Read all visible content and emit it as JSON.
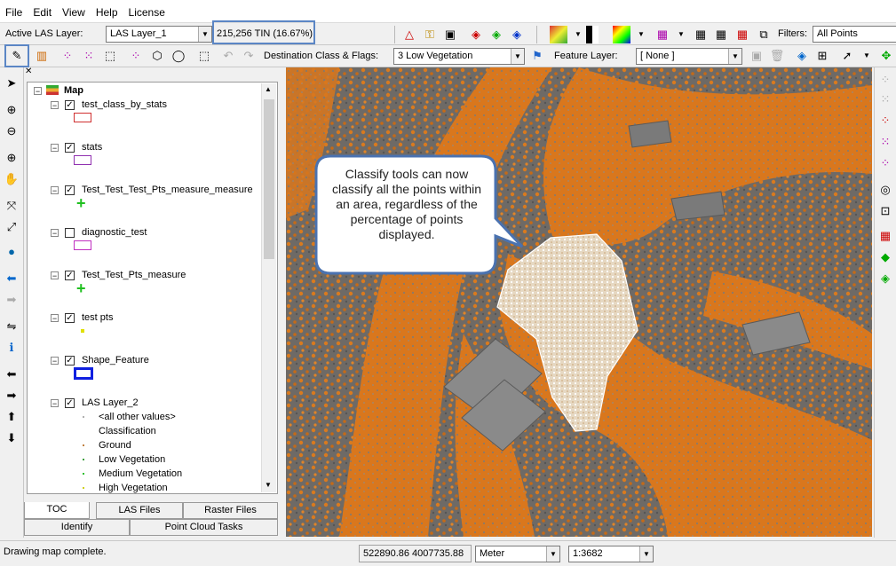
{
  "menu": [
    "File",
    "Edit",
    "View",
    "Help",
    "License"
  ],
  "toolbar1": {
    "active_layer_label": "Active LAS Layer:",
    "active_layer_value": "LAS Layer_1",
    "point_info": "215,256 TIN (16.67%)",
    "filters_label": "Filters:",
    "filters_value": "All Points"
  },
  "toolbar2": {
    "dest_label": "Destination Class & Flags:",
    "dest_value": "3   Low Vegetation",
    "feature_label": "Feature Layer:",
    "feature_value": "[ None ]"
  },
  "toc": {
    "root": "Map",
    "layers": [
      {
        "name": "test_class_by_stats",
        "checked": true,
        "symbol": "rect",
        "color": "#d03030"
      },
      {
        "name": "stats",
        "checked": true,
        "symbol": "rect",
        "color": "#9030b0"
      },
      {
        "name": "Test_Test_Test_Pts_measure_measure",
        "checked": true,
        "symbol": "cross",
        "color": "#20c020"
      },
      {
        "name": "diagnostic_test",
        "checked": false,
        "symbol": "rect",
        "color": "#c030c0"
      },
      {
        "name": "Test_Test_Pts_measure",
        "checked": true,
        "symbol": "cross",
        "color": "#20c020"
      },
      {
        "name": "test pts",
        "checked": true,
        "symbol": "dot",
        "color": "#e0e000"
      },
      {
        "name": "Shape_Feature",
        "checked": true,
        "symbol": "bluebox",
        "color": "#1020e0"
      },
      {
        "name": "LAS Layer_2",
        "checked": true,
        "symbol": "none",
        "color": ""
      }
    ],
    "las_values": [
      {
        "name": "<all other values>",
        "color": "#b0b0b0"
      },
      {
        "name": "Classification",
        "color": ""
      },
      {
        "name": "Ground",
        "color": "#c08040"
      },
      {
        "name": "Low Vegetation",
        "color": "#40a040"
      },
      {
        "name": "Medium Vegetation",
        "color": "#30c030"
      },
      {
        "name": "High Vegetation",
        "color": "#d0d020"
      }
    ]
  },
  "tabs": [
    "TOC",
    "LAS Files",
    "Raster Files",
    "Identify",
    "Point Cloud Tasks"
  ],
  "callout": "Classify tools can now classify all the points within an area, regardless of the percentage of points displayed.",
  "status": {
    "message": "Drawing map complete.",
    "coords": "522890.86 4007735.88",
    "units": "Meter",
    "scale": "1:3682"
  }
}
